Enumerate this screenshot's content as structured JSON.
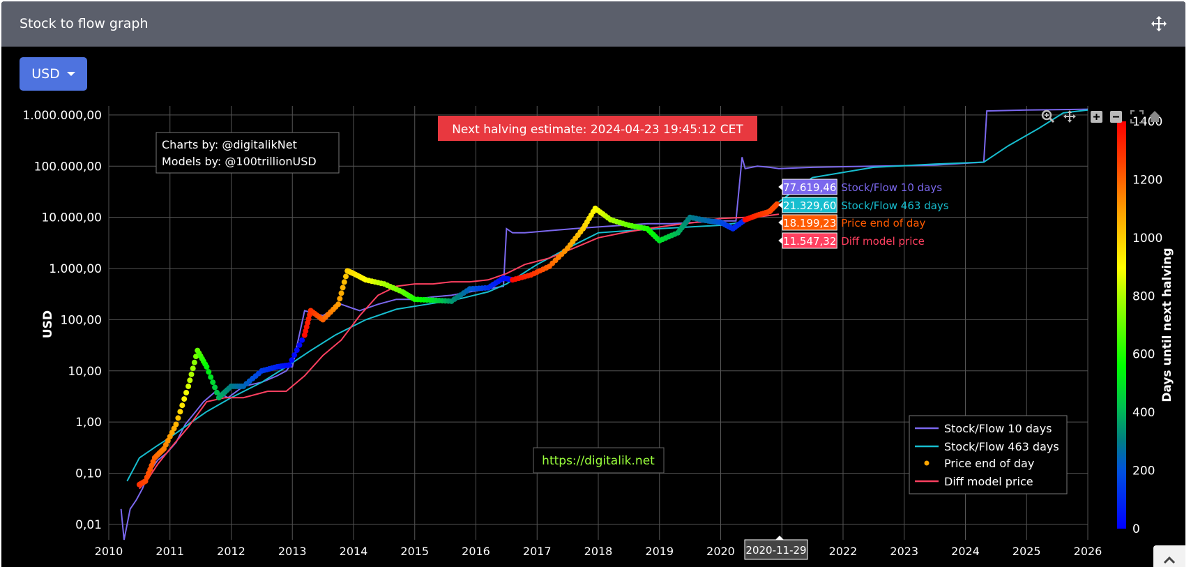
{
  "header": {
    "title": "Stock to flow graph",
    "move_icon": "arrows-move-icon"
  },
  "currency_dropdown": {
    "selected": "USD"
  },
  "chart_data": {
    "type": "line",
    "y_scale": "log",
    "ylabel": "USD",
    "xlabel": "",
    "xlim": [
      2010,
      2026
    ],
    "ylim": [
      0.005,
      1500000
    ],
    "x_ticks": [
      "2010",
      "2011",
      "2012",
      "2013",
      "2014",
      "2015",
      "2016",
      "2017",
      "2018",
      "2019",
      "2020",
      "2022",
      "2023",
      "2024",
      "2025",
      "2026"
    ],
    "y_ticks": [
      {
        "value": 1000000,
        "label": "1.000.000,00"
      },
      {
        "value": 100000,
        "label": "100.000,00"
      },
      {
        "value": 10000,
        "label": "10.000,00"
      },
      {
        "value": 1000,
        "label": "1.000,00"
      },
      {
        "value": 100,
        "label": "100,00"
      },
      {
        "value": 10,
        "label": "10,00"
      },
      {
        "value": 1,
        "label": "1,00"
      },
      {
        "value": 0.1,
        "label": "0,10"
      },
      {
        "value": 0.01,
        "label": "0,01"
      }
    ],
    "grid": true,
    "legend_position": "bottom-right",
    "annotations": {
      "credits_line1": "Charts by: @digitalikNet",
      "credits_line2": "Models by: @100trillionUSD",
      "halving": "Next halving estimate: 2024-04-23 19:45:12 CET",
      "website": "https://digitalik.net",
      "hover_date": "2020-11-29"
    },
    "colorbar": {
      "title": "Days until next halving",
      "min": 0,
      "max": 1400,
      "ticks": [
        "0",
        "200",
        "400",
        "600",
        "800",
        "1000",
        "1200",
        "1400"
      ]
    },
    "hover_labels": [
      {
        "series": "Stock/Flow 10 days",
        "value": "77.619,46",
        "color": "#7b68ee"
      },
      {
        "series": "Stock/Flow 463 days",
        "value": "21.329,60",
        "color": "#17becf"
      },
      {
        "series": "Price end of day",
        "value": "18.199,23",
        "color": "#ff5a00"
      },
      {
        "series": "Diff model price",
        "value": "11.547,32",
        "color": "#ff4060"
      }
    ],
    "series": [
      {
        "name": "Stock/Flow 10 days",
        "color": "#7b68ee",
        "style": "line",
        "x": [
          2010.2,
          2010.25,
          2010.35,
          2010.45,
          2010.55,
          2010.65,
          2010.8,
          2010.95,
          2011.1,
          2011.25,
          2011.4,
          2011.55,
          2011.75,
          2011.95,
          2012.2,
          2012.5,
          2012.75,
          2012.9,
          2012.95,
          2013.0,
          2013.2,
          2013.5,
          2013.8,
          2014.1,
          2014.4,
          2014.7,
          2015.0,
          2015.3,
          2015.6,
          2015.9,
          2016.2,
          2016.45,
          2016.5,
          2016.6,
          2016.8,
          2017.2,
          2017.6,
          2018.0,
          2018.4,
          2018.8,
          2019.2,
          2019.6,
          2020.0,
          2020.25,
          2020.35,
          2020.4,
          2020.6,
          2020.8,
          2020.95,
          2021.5,
          2022.5,
          2023.5,
          2024.3,
          2024.35,
          2025.0,
          2025.6,
          2026.0
        ],
        "y": [
          0.02,
          0.005,
          0.02,
          0.03,
          0.05,
          0.1,
          0.18,
          0.25,
          0.4,
          0.9,
          1.5,
          2.5,
          4,
          3,
          5,
          6,
          8,
          10,
          12,
          12,
          150,
          120,
          200,
          150,
          200,
          250,
          250,
          280,
          300,
          350,
          400,
          450,
          6000,
          5000,
          5000,
          5500,
          6000,
          6500,
          7000,
          7500,
          7500,
          8000,
          8500,
          8500,
          150000,
          90000,
          100000,
          95000,
          90000,
          95000,
          100000,
          105000,
          120000,
          1200000,
          1250000,
          1280000,
          1300000
        ]
      },
      {
        "name": "Stock/Flow 463 days",
        "color": "#17becf",
        "style": "line",
        "x": [
          2010.3,
          2010.5,
          2010.8,
          2011.0,
          2011.3,
          2011.6,
          2012.0,
          2012.5,
          2012.9,
          2013.3,
          2013.7,
          2014.2,
          2014.7,
          2015.2,
          2015.7,
          2016.2,
          2016.5,
          2017.0,
          2017.5,
          2018.0,
          2018.5,
          2019.0,
          2019.5,
          2020.0,
          2020.35,
          2020.7,
          2020.95,
          2021.5,
          2022.5,
          2023.5,
          2024.3,
          2024.7,
          2025.2,
          2025.6,
          2026.0
        ],
        "y": [
          0.07,
          0.2,
          0.35,
          0.5,
          0.9,
          1.6,
          3,
          6,
          12,
          25,
          50,
          100,
          160,
          200,
          250,
          350,
          500,
          1200,
          2500,
          5000,
          5500,
          6000,
          6500,
          7000,
          8000,
          12000,
          20000,
          60000,
          95000,
          110000,
          120000,
          250000,
          550000,
          1100000,
          1250000
        ]
      },
      {
        "name": "Price end of day",
        "color": "#ffa500",
        "style": "markers",
        "colorscale": "rainbow",
        "x": [
          2010.5,
          2010.6,
          2010.75,
          2010.9,
          2011.1,
          2011.3,
          2011.45,
          2011.6,
          2011.8,
          2012.0,
          2012.2,
          2012.5,
          2012.75,
          2012.95,
          2013.2,
          2013.3,
          2013.5,
          2013.75,
          2013.9,
          2014.0,
          2014.2,
          2014.5,
          2014.8,
          2015.0,
          2015.3,
          2015.6,
          2015.9,
          2016.2,
          2016.45,
          2016.6,
          2016.9,
          2017.2,
          2017.5,
          2017.75,
          2017.95,
          2018.2,
          2018.5,
          2018.8,
          2019.0,
          2019.3,
          2019.5,
          2019.8,
          2020.0,
          2020.2,
          2020.4,
          2020.6,
          2020.8,
          2020.92
        ],
        "y": [
          0.06,
          0.07,
          0.2,
          0.3,
          0.9,
          5,
          25,
          12,
          3,
          5,
          5,
          10,
          12,
          13,
          50,
          150,
          100,
          200,
          900,
          800,
          600,
          500,
          350,
          250,
          240,
          230,
          400,
          420,
          650,
          600,
          750,
          1100,
          2500,
          6000,
          15000,
          9000,
          7000,
          6000,
          3500,
          5000,
          10000,
          8500,
          8000,
          6000,
          9000,
          11000,
          13000,
          18199.23
        ],
        "days": [
          1300,
          1250,
          1200,
          1150,
          1050,
          850,
          700,
          550,
          400,
          300,
          250,
          150,
          80,
          20,
          1380,
          1300,
          1200,
          1100,
          1000,
          960,
          900,
          800,
          700,
          600,
          500,
          350,
          230,
          120,
          30,
          1380,
          1300,
          1200,
          1100,
          1000,
          900,
          800,
          700,
          600,
          500,
          400,
          300,
          250,
          200,
          100,
          1380,
          1300,
          1250,
          1240
        ]
      },
      {
        "name": "Diff model price",
        "color": "#ff4060",
        "style": "line",
        "x": [
          2010.5,
          2010.65,
          2010.8,
          2011.0,
          2011.3,
          2011.6,
          2011.9,
          2012.2,
          2012.6,
          2012.9,
          2013.2,
          2013.5,
          2013.8,
          2014.1,
          2014.4,
          2014.7,
          2015.0,
          2015.3,
          2015.6,
          2015.9,
          2016.2,
          2016.5,
          2016.8,
          2017.2,
          2017.6,
          2018.0,
          2018.4,
          2018.8,
          2019.2,
          2019.6,
          2020.0,
          2020.4,
          2020.7,
          2020.95
        ],
        "y": [
          0.05,
          0.08,
          0.15,
          0.3,
          0.8,
          2.5,
          3,
          3,
          4,
          4,
          8,
          20,
          40,
          120,
          300,
          450,
          500,
          500,
          550,
          550,
          600,
          800,
          1200,
          1600,
          2500,
          4000,
          5000,
          6000,
          7000,
          8000,
          9500,
          10000,
          10500,
          11547.32
        ]
      }
    ]
  },
  "toolbar": {
    "zoom_icon": "zoom-icon",
    "pan_icon": "pan-icon",
    "zoom_in_icon": "zoom-in-icon",
    "zoom_out_icon": "zoom-out-icon",
    "autoscale_icon": "autoscale-icon",
    "home_icon": "home-icon"
  },
  "scroll_top_icon": "chevron-up-icon"
}
